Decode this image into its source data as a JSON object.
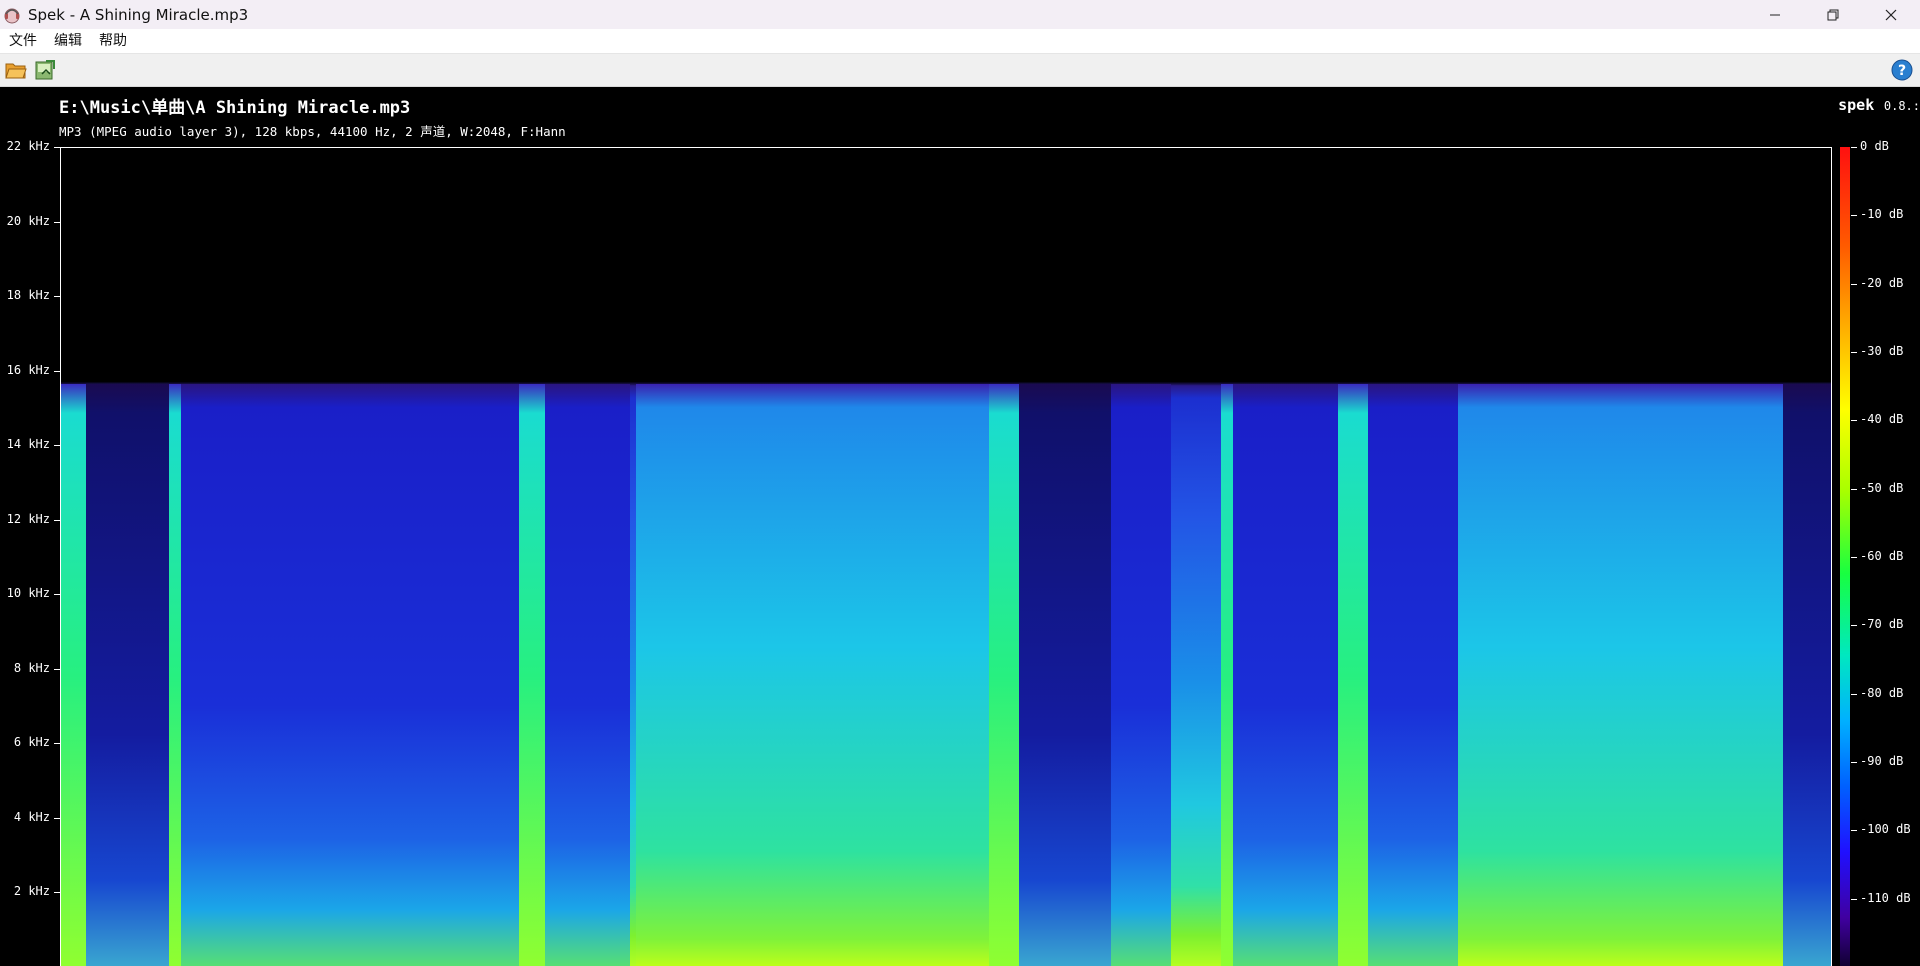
{
  "window": {
    "title": "Spek - A Shining Miracle.mp3",
    "controls": [
      "minimize",
      "restore",
      "close"
    ]
  },
  "menu": {
    "items": [
      {
        "label": "文件"
      },
      {
        "label": "编辑"
      },
      {
        "label": "帮助"
      }
    ]
  },
  "toolbar": {
    "buttons": [
      {
        "icon": "open-folder-icon"
      },
      {
        "icon": "save-image-icon"
      }
    ],
    "help_icon": "help-icon"
  },
  "spek": {
    "file_path": "E:\\Music\\单曲\\A Shining Miracle.mp3",
    "file_info": "MP3 (MPEG audio layer 3), 128 kbps, 44100 Hz, 2 声道, W:2048, F:Hann",
    "brand_name": "spek",
    "brand_version": "0.8.:",
    "freq_axis": {
      "labels": [
        "22 kHz",
        "20 kHz",
        "18 kHz",
        "16 kHz",
        "14 kHz",
        "12 kHz",
        "10 kHz",
        "8 kHz",
        "6 kHz",
        "4 kHz",
        "2 kHz"
      ],
      "values_khz": [
        22,
        20,
        18,
        16,
        14,
        12,
        10,
        8,
        6,
        4,
        2
      ],
      "max_khz": 22
    },
    "db_scale": {
      "labels": [
        "0 dB",
        "-10 dB",
        "-20 dB",
        "-30 dB",
        "-40 dB",
        "-50 dB",
        "-60 dB",
        "-70 dB",
        "-80 dB",
        "-90 dB",
        "-100 dB",
        "-110 dB"
      ],
      "values_db": [
        0,
        -10,
        -20,
        -30,
        -40,
        -50,
        -60,
        -70,
        -80,
        -90,
        -100,
        -110
      ],
      "min_db": -120
    },
    "cutoff_khz": 16,
    "colors": {
      "background": "#000000",
      "text": "#ffffff"
    }
  }
}
